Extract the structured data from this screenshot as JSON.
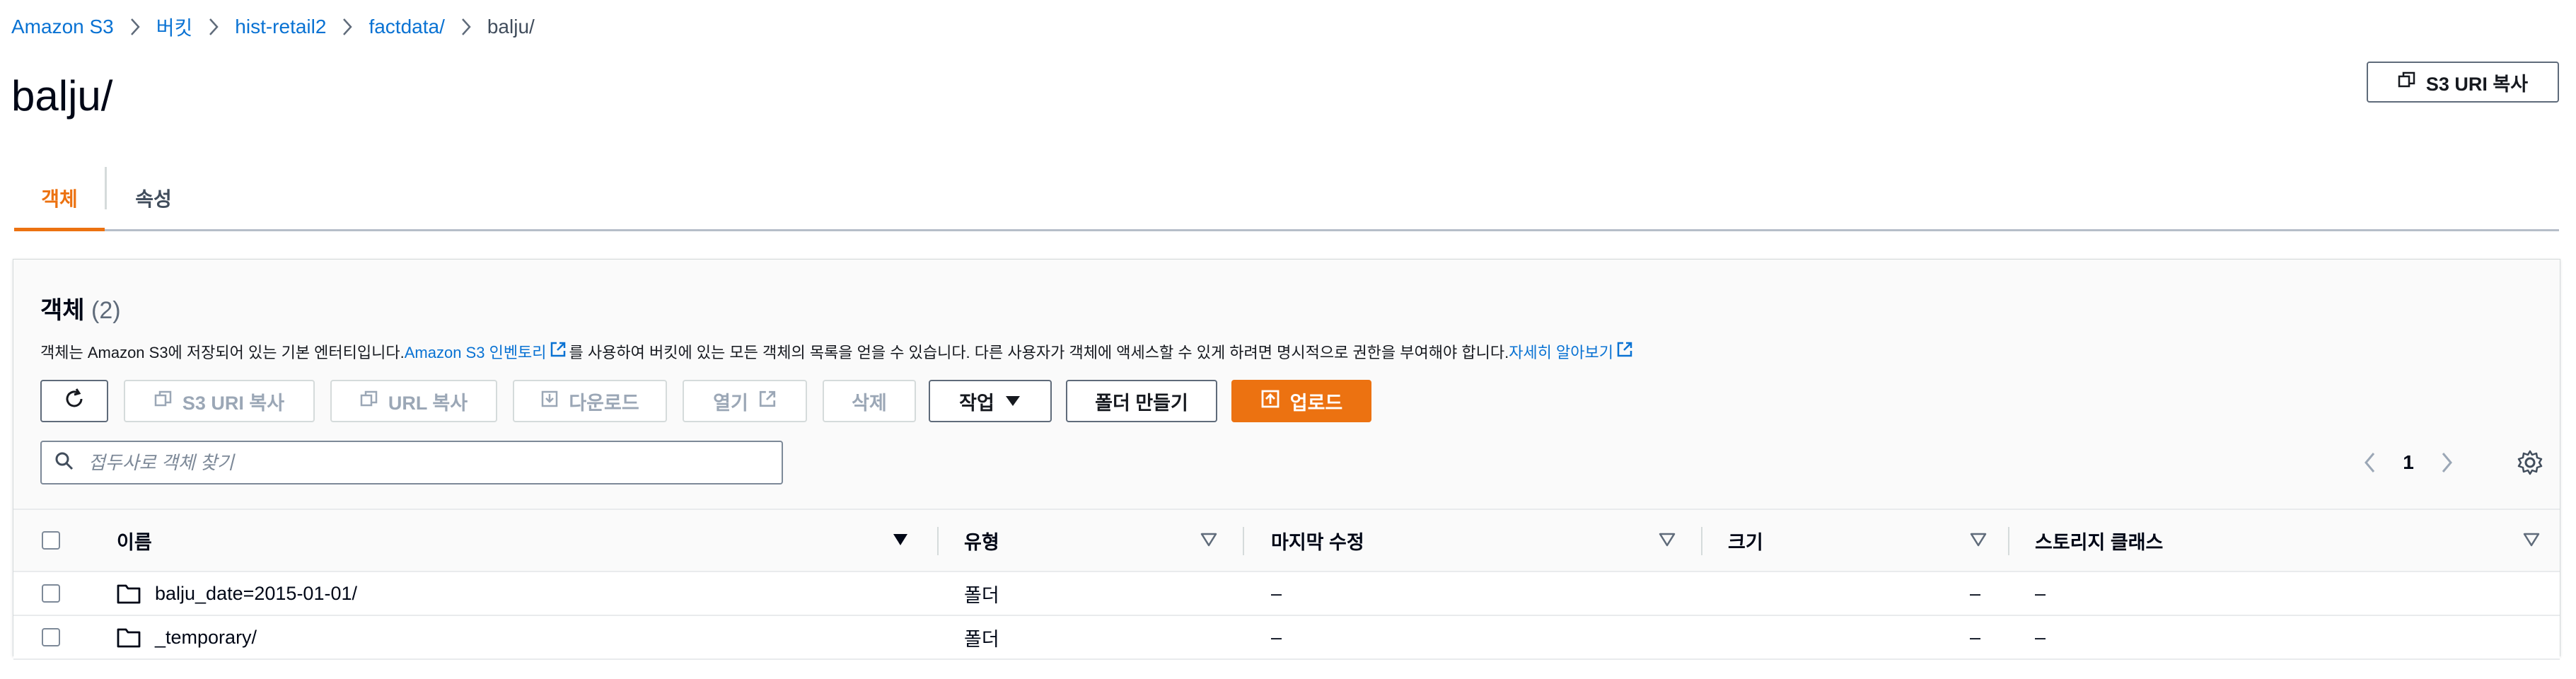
{
  "breadcrumb": {
    "items": [
      "Amazon S3",
      "버킷",
      "hist-retail2",
      "factdata/",
      "balju/"
    ]
  },
  "page": {
    "title": "balju/",
    "copy_uri_button": "S3 URI 복사"
  },
  "tabs": [
    {
      "label": "객체",
      "active": true
    },
    {
      "label": "속성",
      "active": false
    }
  ],
  "objects_panel": {
    "title": "객체",
    "count": "(2)",
    "description": {
      "part1": "객체는 Amazon S3에 저장되어 있는 기본 엔터티입니다. ",
      "inventory_link": "Amazon S3 인벤토리",
      "part2": "를 사용하여 버킷에 있는 모든 객체의 목록을 얻을 수 있습니다. 다른 사용자가 객체에 액세스할 수 있게 하려면 명시적으로 권한을 부여해야 합니다. ",
      "learn_more_link": "자세히 알아보기"
    },
    "toolbar": {
      "copy_s3_uri": "S3 URI 복사",
      "copy_url": "URL 복사",
      "download": "다운로드",
      "open": "열기",
      "delete": "삭제",
      "actions": "작업",
      "create_folder": "폴더 만들기",
      "upload": "업로드"
    },
    "search": {
      "placeholder": "접두사로 객체 찾기",
      "value": ""
    },
    "pagination": {
      "current_page": "1"
    },
    "table": {
      "columns": [
        "이름",
        "유형",
        "마지막 수정",
        "크기",
        "스토리지 클래스"
      ],
      "rows": [
        {
          "name": "balju_date=2015-01-01/",
          "type": "폴더",
          "last_modified": "–",
          "size": "–",
          "storage_class": "–"
        },
        {
          "name": "_temporary/",
          "type": "폴더",
          "last_modified": "–",
          "size": "–",
          "storage_class": "–"
        }
      ]
    }
  },
  "colors": {
    "accent": "#ec7211",
    "link": "#0972d3",
    "text": "#16191f",
    "disabled": "#9ba7b6"
  }
}
